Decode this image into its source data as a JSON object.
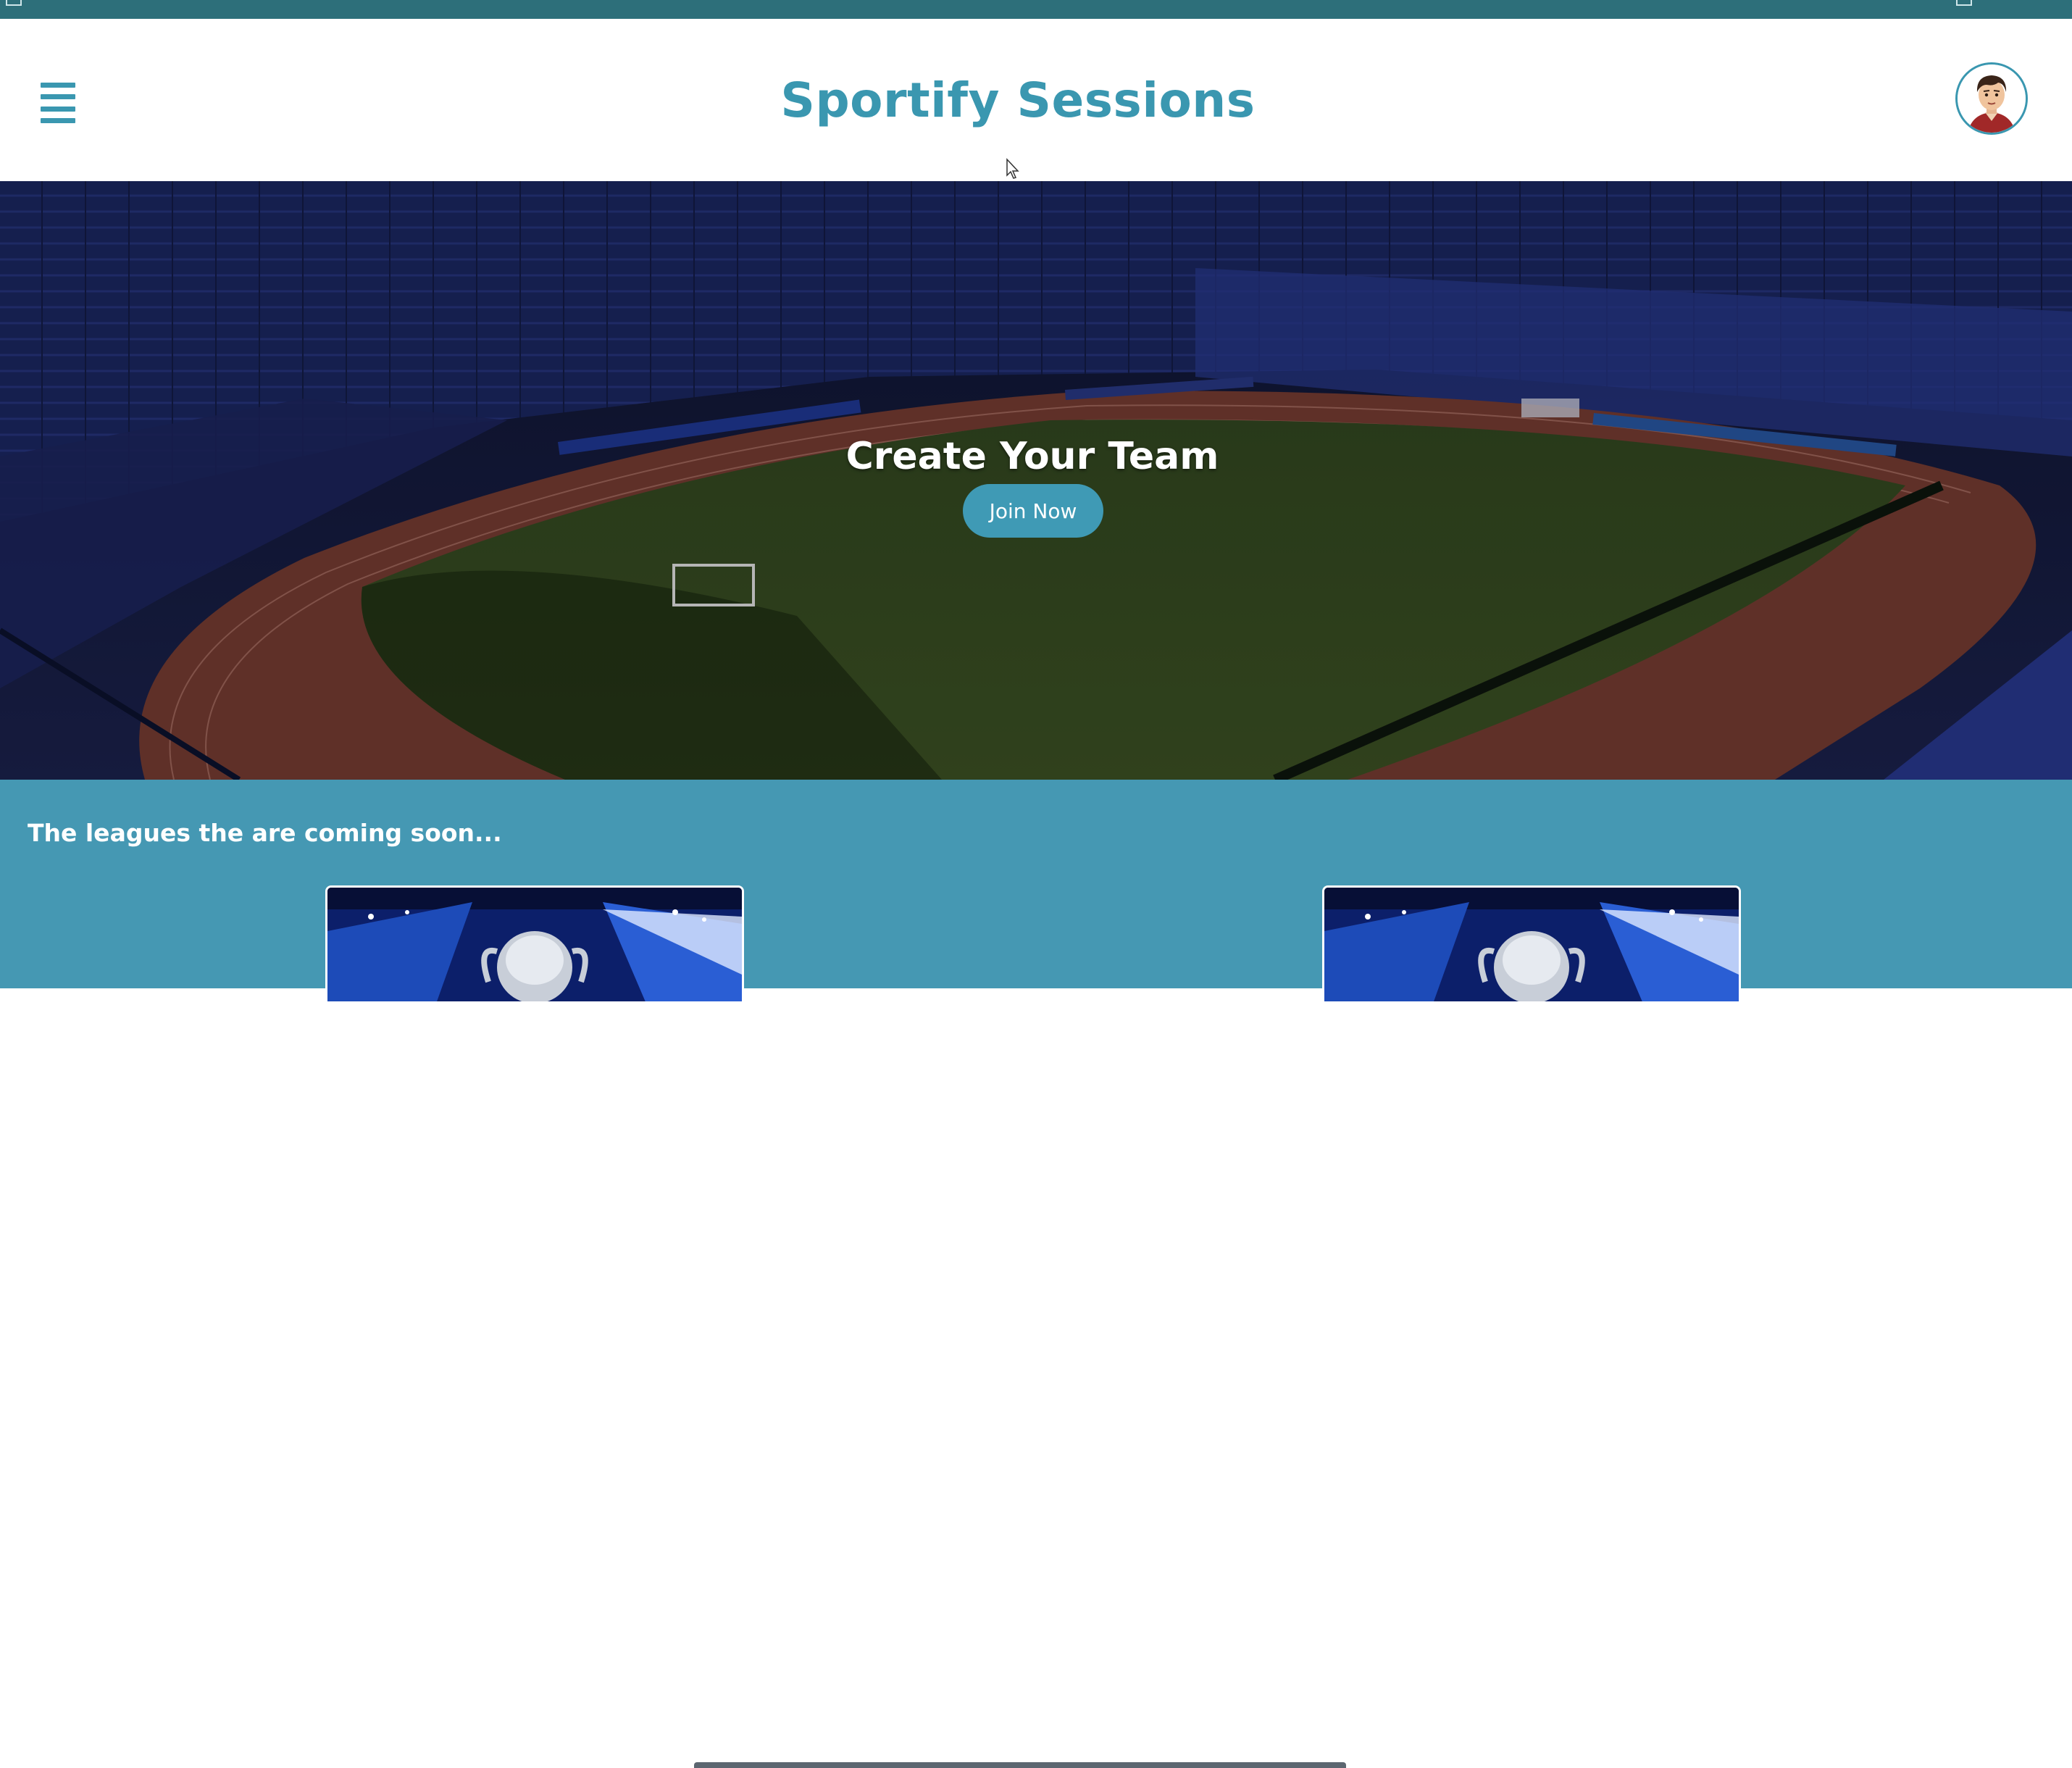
{
  "header": {
    "brand": "Sportify Sessions",
    "menu_icon": "hamburger-menu-icon",
    "avatar_icon": "user-avatar-icon"
  },
  "hero": {
    "title": "Create Your Team",
    "cta_label": "Join Now"
  },
  "leagues": {
    "title": "The leagues the are coming soon...",
    "cards": [
      {
        "image": "champions-league-trophy-image"
      },
      {
        "image": "champions-league-trophy-image"
      }
    ]
  },
  "colors": {
    "brand": "#3a97b0",
    "top_strip": "#2d6f7a",
    "section_bg": "#4598b3",
    "button": "#3f9ab5"
  }
}
